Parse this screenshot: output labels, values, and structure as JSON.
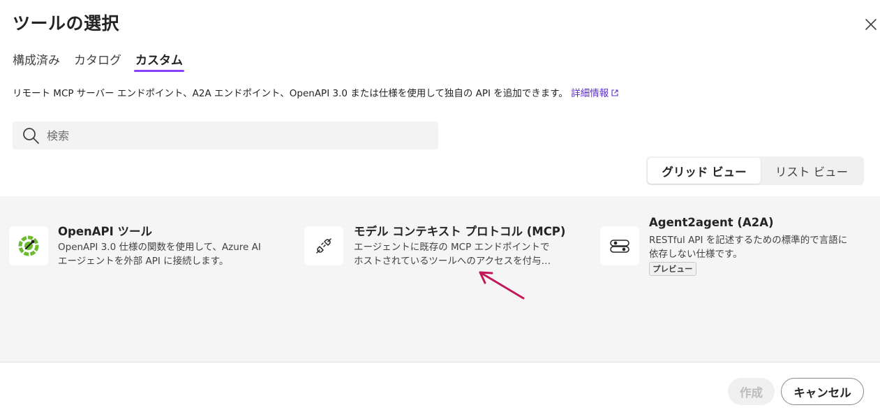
{
  "dialog": {
    "title": "ツールの選択"
  },
  "tabs": [
    {
      "label": "構成済み",
      "active": false
    },
    {
      "label": "カタログ",
      "active": false
    },
    {
      "label": "カスタム",
      "active": true
    }
  ],
  "description": {
    "text": "リモート MCP サーバー エンドポイント、A2A エンドポイント、OpenAPI 3.0 または仕様を使用して独自の API を追加できます。",
    "link_label": "詳細情報"
  },
  "search": {
    "placeholder": "検索",
    "value": ""
  },
  "view_toggle": {
    "grid_label": "グリッド ビュー",
    "list_label": "リスト ビュー",
    "selected": "grid"
  },
  "cards": [
    {
      "icon": "openapi-icon",
      "title": "OpenAPI ツール",
      "desc_line1": "OpenAPI 3.0 仕様の関数を使用して、Azure AI",
      "desc_line2": "エージェントを外部 API に接続します。"
    },
    {
      "icon": "plug-icon",
      "title": "モデル コンテキスト プロトコル (MCP)",
      "desc_line1": "エージェントに既存の MCP エンドポイントで",
      "desc_line2": "ホストされているツールへのアクセスを付与…"
    },
    {
      "icon": "agent-link-icon",
      "title": "Agent2agent (A2A)",
      "desc_line1": "RESTful API を記述するための標準的で言語に",
      "desc_line2": "依存しない仕様です。",
      "badge": "プレビュー"
    }
  ],
  "footer": {
    "create_label": "作成",
    "cancel_label": "キャンセル"
  },
  "colors": {
    "accent": "#8a3ffc",
    "link": "#5b2fc7",
    "annotation_arrow": "#c2185b",
    "openapi_green": "#6cbb2e"
  }
}
